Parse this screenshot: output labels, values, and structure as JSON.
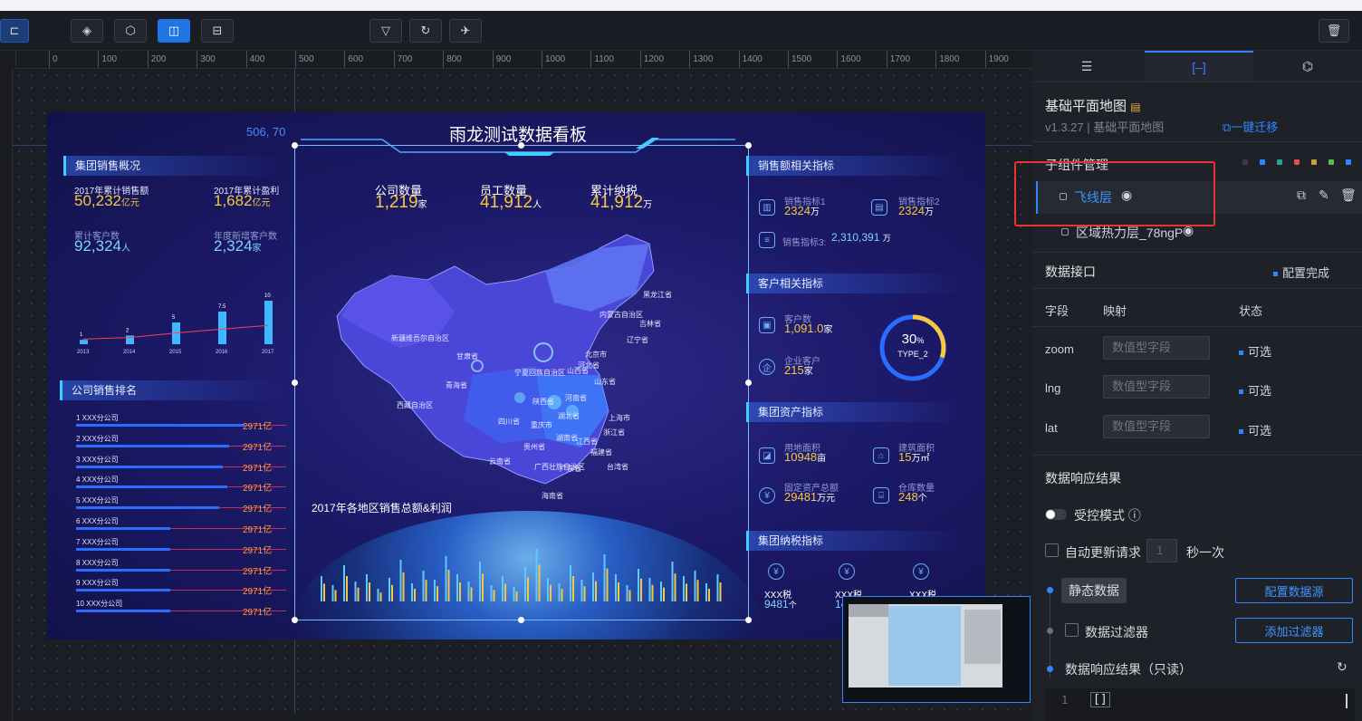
{
  "canvas": {
    "coord_readout": "506, 70"
  },
  "ruler": {
    "ticks": [
      "0",
      "100",
      "200",
      "300",
      "400",
      "500",
      "600",
      "700",
      "800",
      "900",
      "1000",
      "1100",
      "1200",
      "1300",
      "1400",
      "1500",
      "1600",
      "1700",
      "1800",
      "1900"
    ]
  },
  "dashboard": {
    "title": "雨龙测试数据看板",
    "group_sales": {
      "title": "集团销售概况",
      "items": [
        {
          "label": "2017年累计销售额",
          "value": "50,232",
          "unit": "亿元"
        },
        {
          "label": "2017年累计盈利",
          "value": "1,682",
          "unit": "亿元"
        },
        {
          "label": "累计客户数",
          "value": "92,324",
          "unit": "人"
        },
        {
          "label": "年度新增客户数",
          "value": "2,324",
          "unit": "家"
        }
      ],
      "mini_chart": {
        "years": [
          "2013",
          "2014",
          "2015",
          "2016",
          "2017"
        ],
        "values": [
          "1",
          "2",
          "5",
          "7.5",
          "10"
        ]
      }
    },
    "company_rank": {
      "title": "公司销售排名",
      "rows": [
        {
          "name": "1  XXX分公司",
          "value": "2971亿",
          "fill": 0.8
        },
        {
          "name": "2  XXX分公司",
          "value": "2971亿",
          "fill": 0.73
        },
        {
          "name": "3  XXX分公司",
          "value": "2971亿",
          "fill": 0.7
        },
        {
          "name": "4  XXX分公司",
          "value": "2971亿",
          "fill": 0.72
        },
        {
          "name": "5  XXX分公司",
          "value": "2971亿",
          "fill": 0.68
        },
        {
          "name": "6  XXX分公司",
          "value": "2971亿",
          "fill": 0.45
        },
        {
          "name": "7  XXX分公司",
          "value": "2971亿",
          "fill": 0.45
        },
        {
          "name": "8  XXX分公司",
          "value": "2971亿",
          "fill": 0.45
        },
        {
          "name": "9  XXX分公司",
          "value": "2971亿",
          "fill": 0.45
        },
        {
          "name": "10  XXX分公司",
          "value": "2971亿",
          "fill": 0.45
        }
      ]
    },
    "center_kpis": [
      {
        "label": "公司数量",
        "value": "1,219",
        "unit": "家"
      },
      {
        "label": "员工数量",
        "value": "41,912",
        "unit": "人"
      },
      {
        "label": "累计纳税",
        "value": "41,912",
        "unit": "万"
      }
    ],
    "region_chart_title": "2017年各地区销售总额&利润",
    "sales_indicators": {
      "title": "销售额相关指标",
      "items": [
        {
          "label": "销售指标1",
          "value": "2324",
          "unit": "万"
        },
        {
          "label": "销售指标2",
          "value": "2324",
          "unit": "万"
        },
        {
          "label": "销售指标3:",
          "value": "2,310,391",
          "unit": "万"
        }
      ]
    },
    "customer_indicators": {
      "title": "客户相关指标",
      "items": [
        {
          "label": "客户数",
          "value": "1,091.0",
          "unit": "家"
        },
        {
          "label": "企业客户",
          "value": "215",
          "unit": "家"
        }
      ],
      "ring": {
        "percent": "30",
        "unit": "%",
        "label": "TYPE_2",
        "fraction": 0.3
      }
    },
    "asset_indicators": {
      "title": "集团资产指标",
      "items": [
        {
          "label": "用地面积",
          "value": "10948",
          "unit": "亩"
        },
        {
          "label": "建筑面积",
          "value": "15",
          "unit": "万㎡"
        },
        {
          "label": "固定资产总额",
          "value": "29481",
          "unit": "万元"
        },
        {
          "label": "仓库数量",
          "value": "248",
          "unit": "个"
        }
      ]
    },
    "tax_indicators": {
      "title": "集团纳税指标",
      "items": [
        {
          "label": "XXX税",
          "value": "9481",
          "unit": "个"
        },
        {
          "label": "XXX税",
          "value": "14",
          "unit": ""
        },
        {
          "label": "XXX税",
          "value": "",
          "unit": ""
        }
      ]
    },
    "map_labels": [
      "新疆维吾尔自治区",
      "西藏自治区",
      "青海省",
      "甘肃省",
      "四川省",
      "内蒙古自治区",
      "黑龙江省",
      "吉林省",
      "辽宁省",
      "山西省",
      "河南省",
      "湖北省",
      "湖南省",
      "贵州省",
      "云南省",
      "广西壮族自治区",
      "广东省",
      "海南省",
      "江西省",
      "福建省",
      "台湾省",
      "浙江省",
      "上海市",
      "重庆市",
      "陕西省",
      "宁夏回族自治区",
      "北京市",
      "河北省",
      "山东省"
    ]
  },
  "panel": {
    "tabs": [
      "settings",
      "data",
      "interaction"
    ],
    "component_title": "基础平面地图",
    "version_text": "v1.3.27 | 基础平面地图",
    "migrate_link": "一键迁移",
    "sub_manage_title": "子组件管理",
    "sub_components": [
      {
        "name": "飞线层"
      },
      {
        "name": "区域热力层_78ngP"
      }
    ],
    "data_interface": {
      "title": "数据接口",
      "status": "配置完成"
    },
    "field_header": {
      "field": "字段",
      "mapping": "映射",
      "status": "状态"
    },
    "fields": [
      {
        "name": "zoom",
        "placeholder": "数值型字段",
        "status": "可选"
      },
      {
        "name": "lng",
        "placeholder": "数值型字段",
        "status": "可选"
      },
      {
        "name": "lat",
        "placeholder": "数值型字段",
        "status": "可选"
      }
    ],
    "response_title": "数据响应结果",
    "controlled_mode": "受控模式",
    "auto_update": "自动更新请求",
    "interval_value": "1",
    "interval_unit": "秒一次",
    "static_data": "静态数据",
    "config_source": "配置数据源",
    "data_filter": "数据过滤器",
    "add_filter": "添加过滤器",
    "readonly_result": "数据响应结果（只读）",
    "code_line_no": "1",
    "code_text": "[]"
  },
  "colors": {
    "accent": "#2f86ff",
    "highlight_box": "#e8342c"
  }
}
